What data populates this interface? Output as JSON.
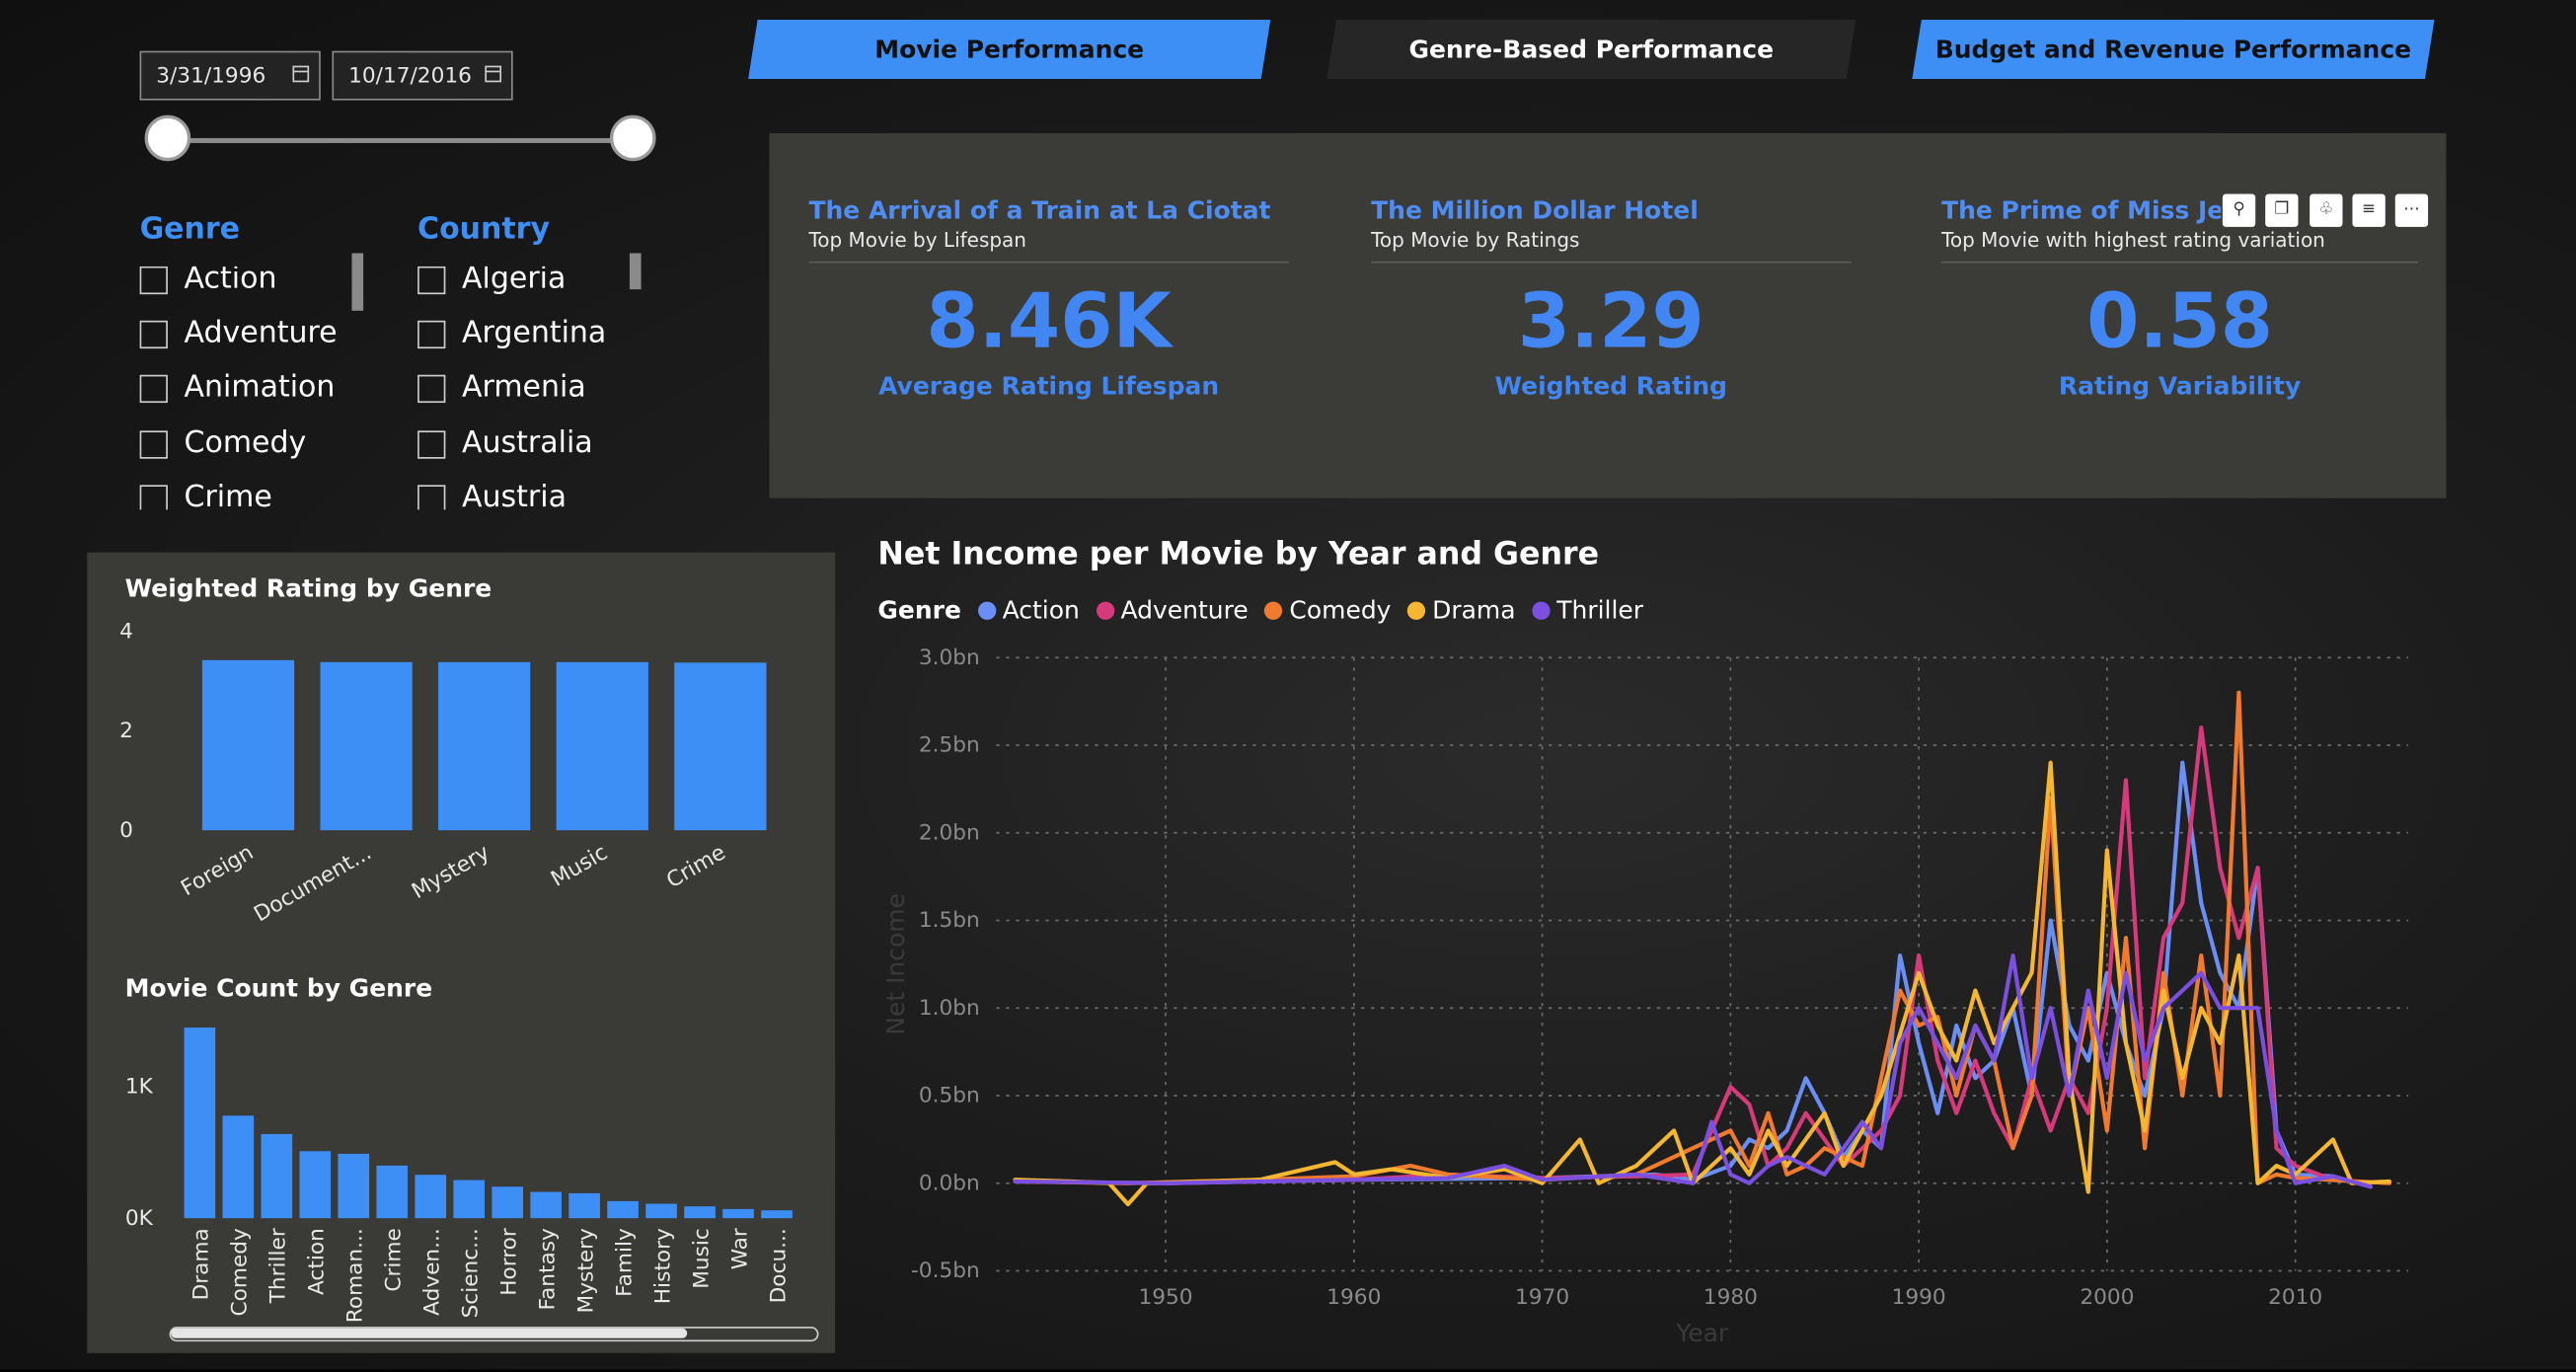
{
  "date_range": {
    "start": "3/31/1996",
    "end": "10/17/2016"
  },
  "filters": {
    "genre": {
      "title": "Genre",
      "items": [
        "Action",
        "Adventure",
        "Animation",
        "Comedy",
        "Crime"
      ]
    },
    "country": {
      "title": "Country",
      "items": [
        "Algeria",
        "Argentina",
        "Armenia",
        "Australia",
        "Austria"
      ]
    }
  },
  "tabs": [
    {
      "label": "Movie Performance",
      "active": true
    },
    {
      "label": "Genre-Based Performance",
      "active": false
    },
    {
      "label": "Budget and Revenue Performance",
      "active": true
    }
  ],
  "kpis": [
    {
      "title": "The Arrival of a Train at La Ciotat",
      "subtitle": "Top Movie by Lifespan",
      "value": "8.46K",
      "label": "Average Rating Lifespan"
    },
    {
      "title": "The Million Dollar Hotel",
      "subtitle": "Top Movie by Ratings",
      "value": "3.29",
      "label": "Weighted Rating"
    },
    {
      "title": "The Prime of Miss Jean Brodie",
      "subtitle": "Top Movie with highest rating variation",
      "value": "0.58",
      "label": "Rating Variability"
    }
  ],
  "visual_header_icons": [
    "pin-icon",
    "copy-icon",
    "bell-icon",
    "filter-icon",
    "more-icon"
  ],
  "colors": {
    "accent": "#4286f4",
    "panel": "#3a3a36",
    "action": "#6b8ef5",
    "adventure": "#d63a7a",
    "comedy": "#f07a2e",
    "drama": "#f5b731",
    "thriller": "#7b4fe0"
  },
  "chart_data": [
    {
      "type": "bar",
      "title": "Weighted Rating by Genre",
      "categories": [
        "Foreign",
        "Document...",
        "Mystery",
        "Music",
        "Crime"
      ],
      "values": [
        3.42,
        3.38,
        3.38,
        3.38,
        3.37
      ],
      "yticks": [
        "0",
        "2",
        "4"
      ],
      "ylim": [
        0,
        4
      ]
    },
    {
      "type": "bar",
      "title": "Movie Count by Genre",
      "categories": [
        "Drama",
        "Comedy",
        "Thriller",
        "Action",
        "Roman...",
        "Crime",
        "Adven...",
        "Scienc...",
        "Horror",
        "Fantasy",
        "Mystery",
        "Family",
        "History",
        "Music",
        "War",
        "Docu..."
      ],
      "values": [
        1450,
        780,
        640,
        510,
        490,
        400,
        330,
        290,
        240,
        200,
        190,
        130,
        110,
        90,
        70,
        60
      ],
      "yticks": [
        "0K",
        "1K"
      ],
      "ylim": [
        0,
        1500
      ]
    },
    {
      "type": "line",
      "title": "Net Income per Movie by Year and Genre",
      "legend_title": "Genre",
      "xlabel": "Year",
      "ylabel": "Net Income",
      "xticks": [
        "1950",
        "1960",
        "1970",
        "1980",
        "1990",
        "2000",
        "2010"
      ],
      "yticks": [
        "-0.5bn",
        "0.0bn",
        "0.5bn",
        "1.0bn",
        "1.5bn",
        "2.0bn",
        "2.5bn",
        "3.0bn"
      ],
      "xlim": [
        1941,
        2016
      ],
      "ylim": [
        -0.5,
        3.0
      ],
      "series": [
        {
          "name": "Action",
          "color": "#6b8ef5",
          "points": [
            [
              1942,
              0.01
            ],
            [
              1950,
              0.0
            ],
            [
              1960,
              0.02
            ],
            [
              1970,
              0.03
            ],
            [
              1976,
              0.05
            ],
            [
              1978,
              0.02
            ],
            [
              1980,
              0.1
            ],
            [
              1981,
              0.25
            ],
            [
              1982,
              0.2
            ],
            [
              1983,
              0.3
            ],
            [
              1984,
              0.6
            ],
            [
              1985,
              0.4
            ],
            [
              1986,
              0.15
            ],
            [
              1987,
              0.3
            ],
            [
              1988,
              0.2
            ],
            [
              1989,
              1.3
            ],
            [
              1990,
              0.8
            ],
            [
              1991,
              0.4
            ],
            [
              1992,
              0.9
            ],
            [
              1993,
              0.6
            ],
            [
              1994,
              0.7
            ],
            [
              1995,
              1.0
            ],
            [
              1996,
              0.5
            ],
            [
              1997,
              1.5
            ],
            [
              1998,
              0.9
            ],
            [
              1999,
              0.7
            ],
            [
              2000,
              1.2
            ],
            [
              2001,
              0.8
            ],
            [
              2002,
              0.5
            ],
            [
              2003,
              1.0
            ],
            [
              2004,
              2.4
            ],
            [
              2005,
              1.6
            ],
            [
              2006,
              1.2
            ],
            [
              2007,
              1.0
            ],
            [
              2008,
              1.8
            ],
            [
              2009,
              0.3
            ],
            [
              2010,
              0.05
            ],
            [
              2012,
              0.04
            ],
            [
              2014,
              -0.02
            ]
          ]
        },
        {
          "name": "Adventure",
          "color": "#d63a7a",
          "points": [
            [
              1942,
              0.01
            ],
            [
              1950,
              0.0
            ],
            [
              1960,
              0.02
            ],
            [
              1965,
              0.05
            ],
            [
              1970,
              0.03
            ],
            [
              1975,
              0.04
            ],
            [
              1978,
              0.05
            ],
            [
              1980,
              0.55
            ],
            [
              1981,
              0.45
            ],
            [
              1982,
              0.1
            ],
            [
              1983,
              0.2
            ],
            [
              1984,
              0.4
            ],
            [
              1985,
              0.25
            ],
            [
              1986,
              0.1
            ],
            [
              1987,
              0.2
            ],
            [
              1988,
              0.3
            ],
            [
              1989,
              0.5
            ],
            [
              1990,
              1.3
            ],
            [
              1991,
              0.7
            ],
            [
              1992,
              0.4
            ],
            [
              1993,
              0.7
            ],
            [
              1994,
              0.4
            ],
            [
              1995,
              0.2
            ],
            [
              1996,
              0.6
            ],
            [
              1997,
              0.3
            ],
            [
              1998,
              0.6
            ],
            [
              1999,
              0.4
            ],
            [
              2000,
              1.0
            ],
            [
              2001,
              2.3
            ],
            [
              2002,
              0.6
            ],
            [
              2003,
              1.4
            ],
            [
              2004,
              1.6
            ],
            [
              2005,
              2.6
            ],
            [
              2006,
              1.8
            ],
            [
              2007,
              1.4
            ],
            [
              2008,
              1.8
            ],
            [
              2009,
              0.2
            ],
            [
              2010,
              0.1
            ],
            [
              2012,
              0.02
            ]
          ]
        },
        {
          "name": "Comedy",
          "color": "#f07a2e",
          "points": [
            [
              1942,
              0.01
            ],
            [
              1948,
              0.0
            ],
            [
              1955,
              0.02
            ],
            [
              1960,
              0.04
            ],
            [
              1963,
              0.1
            ],
            [
              1965,
              0.05
            ],
            [
              1970,
              0.02
            ],
            [
              1975,
              0.05
            ],
            [
              1980,
              0.3
            ],
            [
              1981,
              0.1
            ],
            [
              1982,
              0.4
            ],
            [
              1983,
              0.05
            ],
            [
              1984,
              0.1
            ],
            [
              1985,
              0.2
            ],
            [
              1986,
              0.15
            ],
            [
              1987,
              0.1
            ],
            [
              1988,
              0.6
            ],
            [
              1989,
              1.1
            ],
            [
              1990,
              0.9
            ],
            [
              1991,
              0.95
            ],
            [
              1992,
              0.5
            ],
            [
              1993,
              0.9
            ],
            [
              1994,
              0.7
            ],
            [
              1995,
              0.2
            ],
            [
              1996,
              0.5
            ],
            [
              1997,
              2.2
            ],
            [
              1998,
              0.5
            ],
            [
              1999,
              1.0
            ],
            [
              2000,
              0.3
            ],
            [
              2001,
              1.4
            ],
            [
              2002,
              0.2
            ],
            [
              2003,
              1.2
            ],
            [
              2004,
              0.5
            ],
            [
              2005,
              1.3
            ],
            [
              2006,
              0.5
            ],
            [
              2007,
              2.8
            ],
            [
              2008,
              0.0
            ],
            [
              2009,
              0.05
            ],
            [
              2010,
              0.03
            ],
            [
              2015,
              0.0
            ]
          ]
        },
        {
          "name": "Drama",
          "color": "#f5b731",
          "points": [
            [
              1942,
              0.02
            ],
            [
              1945,
              0.01
            ],
            [
              1947,
              0.0
            ],
            [
              1948,
              -0.12
            ],
            [
              1949,
              0.0
            ],
            [
              1955,
              0.02
            ],
            [
              1959,
              0.12
            ],
            [
              1960,
              0.05
            ],
            [
              1962,
              0.08
            ],
            [
              1965,
              0.03
            ],
            [
              1968,
              0.08
            ],
            [
              1970,
              0.0
            ],
            [
              1972,
              0.25
            ],
            [
              1973,
              0.0
            ],
            [
              1975,
              0.1
            ],
            [
              1977,
              0.3
            ],
            [
              1978,
              0.0
            ],
            [
              1980,
              0.2
            ],
            [
              1981,
              0.05
            ],
            [
              1982,
              0.3
            ],
            [
              1983,
              0.1
            ],
            [
              1985,
              0.4
            ],
            [
              1986,
              0.1
            ],
            [
              1988,
              0.5
            ],
            [
              1990,
              1.2
            ],
            [
              1991,
              0.9
            ],
            [
              1992,
              0.7
            ],
            [
              1993,
              1.1
            ],
            [
              1994,
              0.8
            ],
            [
              1995,
              1.0
            ],
            [
              1996,
              1.2
            ],
            [
              1997,
              2.4
            ],
            [
              1998,
              0.6
            ],
            [
              1999,
              -0.05
            ],
            [
              2000,
              1.9
            ],
            [
              2001,
              0.8
            ],
            [
              2002,
              0.3
            ],
            [
              2003,
              1.1
            ],
            [
              2004,
              0.6
            ],
            [
              2005,
              1.0
            ],
            [
              2006,
              0.8
            ],
            [
              2007,
              1.3
            ],
            [
              2008,
              0.0
            ],
            [
              2009,
              0.1
            ],
            [
              2010,
              0.05
            ],
            [
              2012,
              0.25
            ],
            [
              2013,
              0.0
            ],
            [
              2015,
              0.01
            ]
          ]
        },
        {
          "name": "Thriller",
          "color": "#7b4fe0",
          "points": [
            [
              1942,
              0.01
            ],
            [
              1950,
              0.0
            ],
            [
              1955,
              0.01
            ],
            [
              1960,
              0.02
            ],
            [
              1965,
              0.03
            ],
            [
              1968,
              0.1
            ],
            [
              1970,
              0.02
            ],
            [
              1975,
              0.05
            ],
            [
              1978,
              0.0
            ],
            [
              1979,
              0.35
            ],
            [
              1980,
              0.05
            ],
            [
              1981,
              0.0
            ],
            [
              1982,
              0.1
            ],
            [
              1983,
              0.15
            ],
            [
              1985,
              0.05
            ],
            [
              1987,
              0.35
            ],
            [
              1988,
              0.2
            ],
            [
              1989,
              0.8
            ],
            [
              1990,
              1.0
            ],
            [
              1991,
              0.8
            ],
            [
              1992,
              0.6
            ],
            [
              1993,
              0.9
            ],
            [
              1994,
              0.7
            ],
            [
              1995,
              1.3
            ],
            [
              1996,
              0.6
            ],
            [
              1997,
              1.0
            ],
            [
              1998,
              0.5
            ],
            [
              1999,
              1.1
            ],
            [
              2000,
              0.6
            ],
            [
              2001,
              1.2
            ],
            [
              2002,
              0.7
            ],
            [
              2003,
              1.0
            ],
            [
              2004,
              1.1
            ],
            [
              2005,
              1.2
            ],
            [
              2006,
              1.0
            ],
            [
              2007,
              1.0
            ],
            [
              2008,
              1.0
            ],
            [
              2009,
              0.3
            ],
            [
              2010,
              0.0
            ],
            [
              2012,
              0.04
            ],
            [
              2014,
              -0.02
            ]
          ]
        }
      ]
    }
  ]
}
